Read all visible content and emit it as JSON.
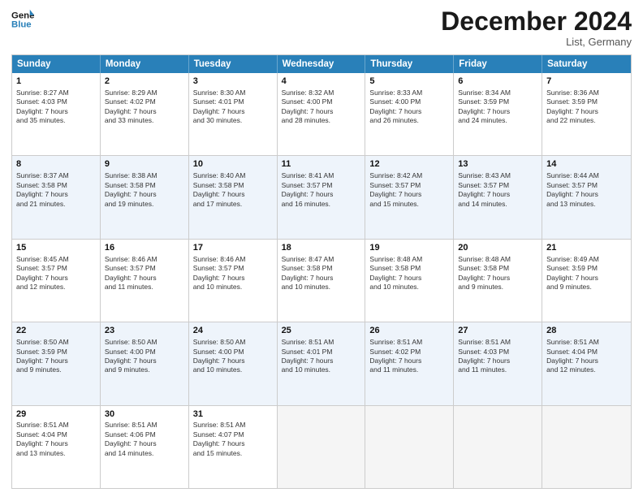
{
  "header": {
    "logo_line1": "General",
    "logo_line2": "Blue",
    "month": "December 2024",
    "location": "List, Germany"
  },
  "days": [
    "Sunday",
    "Monday",
    "Tuesday",
    "Wednesday",
    "Thursday",
    "Friday",
    "Saturday"
  ],
  "rows": [
    [
      {
        "day": "1",
        "sunrise": "8:27 AM",
        "sunset": "4:03 PM",
        "daylight": "7 hours and 35 minutes."
      },
      {
        "day": "2",
        "sunrise": "8:29 AM",
        "sunset": "4:02 PM",
        "daylight": "7 hours and 33 minutes."
      },
      {
        "day": "3",
        "sunrise": "8:30 AM",
        "sunset": "4:01 PM",
        "daylight": "7 hours and 30 minutes."
      },
      {
        "day": "4",
        "sunrise": "8:32 AM",
        "sunset": "4:00 PM",
        "daylight": "7 hours and 28 minutes."
      },
      {
        "day": "5",
        "sunrise": "8:33 AM",
        "sunset": "4:00 PM",
        "daylight": "7 hours and 26 minutes."
      },
      {
        "day": "6",
        "sunrise": "8:34 AM",
        "sunset": "3:59 PM",
        "daylight": "7 hours and 24 minutes."
      },
      {
        "day": "7",
        "sunrise": "8:36 AM",
        "sunset": "3:59 PM",
        "daylight": "7 hours and 22 minutes."
      }
    ],
    [
      {
        "day": "8",
        "sunrise": "8:37 AM",
        "sunset": "3:58 PM",
        "daylight": "7 hours and 21 minutes."
      },
      {
        "day": "9",
        "sunrise": "8:38 AM",
        "sunset": "3:58 PM",
        "daylight": "7 hours and 19 minutes."
      },
      {
        "day": "10",
        "sunrise": "8:40 AM",
        "sunset": "3:58 PM",
        "daylight": "7 hours and 17 minutes."
      },
      {
        "day": "11",
        "sunrise": "8:41 AM",
        "sunset": "3:57 PM",
        "daylight": "7 hours and 16 minutes."
      },
      {
        "day": "12",
        "sunrise": "8:42 AM",
        "sunset": "3:57 PM",
        "daylight": "7 hours and 15 minutes."
      },
      {
        "day": "13",
        "sunrise": "8:43 AM",
        "sunset": "3:57 PM",
        "daylight": "7 hours and 14 minutes."
      },
      {
        "day": "14",
        "sunrise": "8:44 AM",
        "sunset": "3:57 PM",
        "daylight": "7 hours and 13 minutes."
      }
    ],
    [
      {
        "day": "15",
        "sunrise": "8:45 AM",
        "sunset": "3:57 PM",
        "daylight": "7 hours and 12 minutes."
      },
      {
        "day": "16",
        "sunrise": "8:46 AM",
        "sunset": "3:57 PM",
        "daylight": "7 hours and 11 minutes."
      },
      {
        "day": "17",
        "sunrise": "8:46 AM",
        "sunset": "3:57 PM",
        "daylight": "7 hours and 10 minutes."
      },
      {
        "day": "18",
        "sunrise": "8:47 AM",
        "sunset": "3:58 PM",
        "daylight": "7 hours and 10 minutes."
      },
      {
        "day": "19",
        "sunrise": "8:48 AM",
        "sunset": "3:58 PM",
        "daylight": "7 hours and 10 minutes."
      },
      {
        "day": "20",
        "sunrise": "8:48 AM",
        "sunset": "3:58 PM",
        "daylight": "7 hours and 9 minutes."
      },
      {
        "day": "21",
        "sunrise": "8:49 AM",
        "sunset": "3:59 PM",
        "daylight": "7 hours and 9 minutes."
      }
    ],
    [
      {
        "day": "22",
        "sunrise": "8:50 AM",
        "sunset": "3:59 PM",
        "daylight": "7 hours and 9 minutes."
      },
      {
        "day": "23",
        "sunrise": "8:50 AM",
        "sunset": "4:00 PM",
        "daylight": "7 hours and 9 minutes."
      },
      {
        "day": "24",
        "sunrise": "8:50 AM",
        "sunset": "4:00 PM",
        "daylight": "7 hours and 10 minutes."
      },
      {
        "day": "25",
        "sunrise": "8:51 AM",
        "sunset": "4:01 PM",
        "daylight": "7 hours and 10 minutes."
      },
      {
        "day": "26",
        "sunrise": "8:51 AM",
        "sunset": "4:02 PM",
        "daylight": "7 hours and 11 minutes."
      },
      {
        "day": "27",
        "sunrise": "8:51 AM",
        "sunset": "4:03 PM",
        "daylight": "7 hours and 11 minutes."
      },
      {
        "day": "28",
        "sunrise": "8:51 AM",
        "sunset": "4:04 PM",
        "daylight": "7 hours and 12 minutes."
      }
    ],
    [
      {
        "day": "29",
        "sunrise": "8:51 AM",
        "sunset": "4:04 PM",
        "daylight": "7 hours and 13 minutes."
      },
      {
        "day": "30",
        "sunrise": "8:51 AM",
        "sunset": "4:06 PM",
        "daylight": "7 hours and 14 minutes."
      },
      {
        "day": "31",
        "sunrise": "8:51 AM",
        "sunset": "4:07 PM",
        "daylight": "7 hours and 15 minutes."
      },
      null,
      null,
      null,
      null
    ]
  ],
  "labels": {
    "sunrise": "Sunrise:",
    "sunset": "Sunset:",
    "daylight": "Daylight:"
  }
}
